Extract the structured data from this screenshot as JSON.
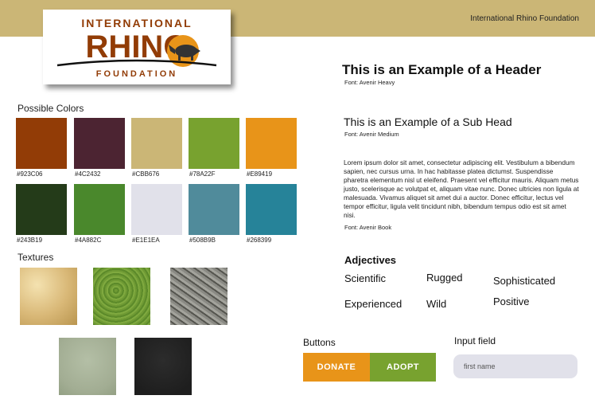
{
  "header": {
    "organization": "International Rhino Foundation"
  },
  "logo": {
    "top_text": "INTERNATIONAL",
    "main_text": "RHINO",
    "bottom_text": "FOUNDATION"
  },
  "palette": {
    "title": "Possible Colors",
    "colors": [
      {
        "label": "#923C06",
        "hex": "#923C06"
      },
      {
        "label": "#4C2432",
        "hex": "#4C2432"
      },
      {
        "label": "#CBB676",
        "hex": "#CBB676"
      },
      {
        "label": "#78A22F",
        "hex": "#78A22F"
      },
      {
        "label": "#E89419",
        "hex": "#E89419"
      },
      {
        "label": "#243B19",
        "hex": "#243B19"
      },
      {
        "label": "#4A882C",
        "hex": "#4A882C"
      },
      {
        "label": "#E1E1EA",
        "hex": "#E1E1EA"
      },
      {
        "label": "#508B9B",
        "hex": "#508B9B"
      },
      {
        "label": "#268399",
        "hex": "#268399"
      }
    ]
  },
  "textures": {
    "title": "Textures",
    "items": [
      "parchment",
      "grass",
      "rhino-skin",
      "sage-gray",
      "charcoal"
    ]
  },
  "typography": {
    "header_text": "This is an Example of a Header",
    "header_font": "Font: Avenir Heavy",
    "subhead_text": "This is an Example of a Sub Head",
    "subhead_font": "Font: Avenir Medium",
    "body_text": "Lorem ipsum dolor sit amet, consectetur adipiscing elit. Vestibulum a bibendum sapien, nec cursus urna. In hac habitasse platea dictumst. Suspendisse pharetra elementum nisl ut eleifend. Praesent vel efficitur mauris. Aliquam metus justo, scelerisque ac volutpat et, aliquam vitae nunc. Donec ultricies non ligula at malesuada. Vivamus aliquet sit amet dui a auctor. Donec efficitur, lectus vel tempor efficitur, ligula velit tincidunt nibh, bibendum tempus odio est sit amet nisi.",
    "body_font": "Font: Avenir Book"
  },
  "adjectives": {
    "title": "Adjectives",
    "words": [
      "Scientific",
      "Rugged",
      "Sophisticated",
      "Experienced",
      "Wild",
      "Positive"
    ]
  },
  "buttons": {
    "title": "Buttons",
    "donate": {
      "label": "DONATE",
      "color": "#E89419"
    },
    "adopt": {
      "label": "ADOPT",
      "color": "#78A22F"
    }
  },
  "input": {
    "title": "Input field",
    "placeholder": "first name",
    "value": ""
  }
}
